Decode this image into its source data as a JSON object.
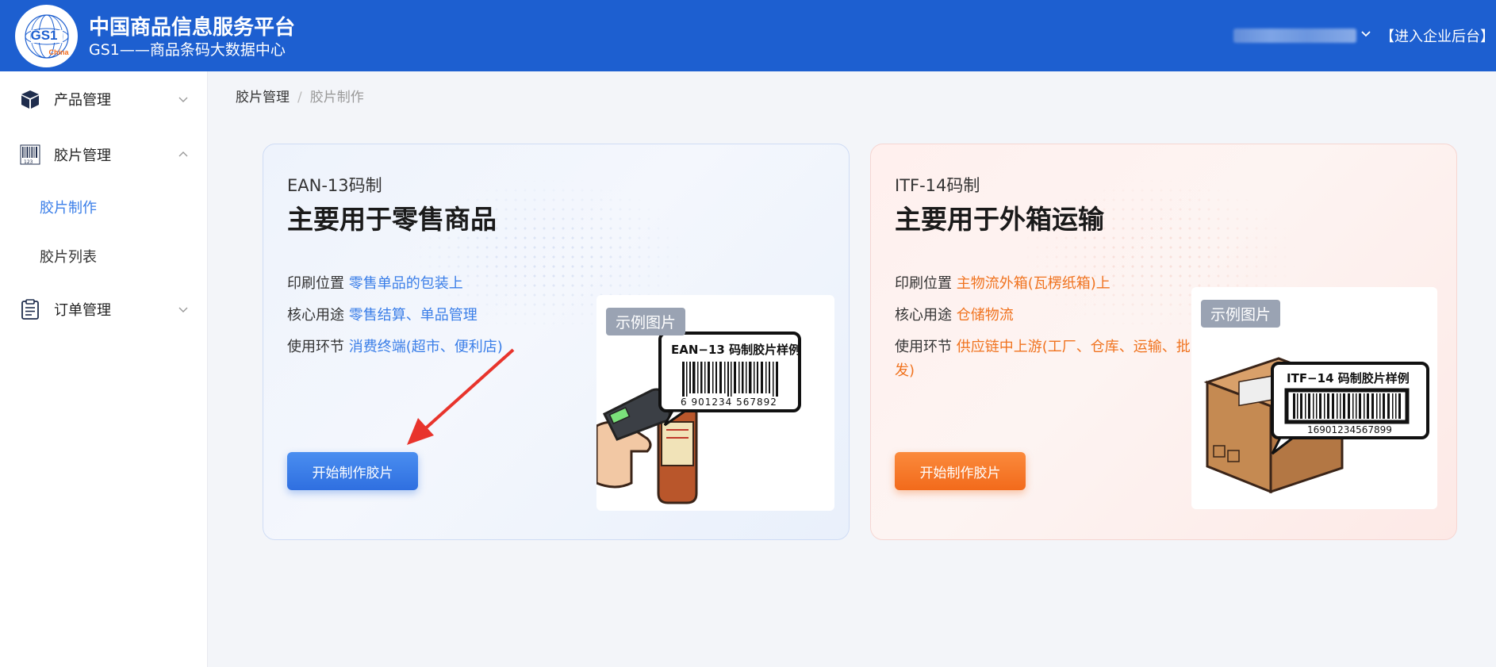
{
  "header": {
    "logo_text": "GS1",
    "logo_sub": "China",
    "title": "中国商品信息服务平台",
    "subtitle": "GS1——商品条码大数据中心",
    "enter_backend": "【进入企业后台】"
  },
  "sidebar": {
    "items": [
      {
        "label": "产品管理",
        "icon": "cube-icon",
        "expanded": false
      },
      {
        "label": "胶片管理",
        "icon": "barcode-icon",
        "expanded": true,
        "children": [
          {
            "label": "胶片制作",
            "active": true
          },
          {
            "label": "胶片列表",
            "active": false
          }
        ]
      },
      {
        "label": "订单管理",
        "icon": "clipboard-icon",
        "expanded": false
      }
    ]
  },
  "breadcrumb": {
    "parent": "胶片管理",
    "separator": "/",
    "current": "胶片制作"
  },
  "cards": [
    {
      "code": "EAN-13码制",
      "title": "主要用于零售商品",
      "rows": [
        {
          "label": "印刷位置",
          "value": "零售单品的包装上"
        },
        {
          "label": "核心用途",
          "value": "零售结算、单品管理"
        },
        {
          "label": "使用环节",
          "value": "消费终端(超市、便利店)"
        }
      ],
      "button": "开始制作胶片",
      "sample_tag": "示例图片",
      "sample_label": "EAN−13 码制胶片样例",
      "sample_number": "6 901234 567892",
      "accent": "#3a7ee8"
    },
    {
      "code": "ITF-14码制",
      "title": "主要用于外箱运输",
      "rows": [
        {
          "label": "印刷位置",
          "value": "主物流外箱(瓦楞纸箱)上"
        },
        {
          "label": "核心用途",
          "value": "仓储物流"
        },
        {
          "label": "使用环节",
          "value": "供应链中上游(工厂、仓库、运输、批发)"
        }
      ],
      "button": "开始制作胶片",
      "sample_tag": "示例图片",
      "sample_label": "ITF−14 码制胶片样例",
      "sample_number": "16901234567899",
      "accent": "#f0731f"
    }
  ],
  "colors": {
    "header_bg": "#1d5fd0",
    "primary": "#3a7ee8",
    "orange": "#f0731f"
  }
}
